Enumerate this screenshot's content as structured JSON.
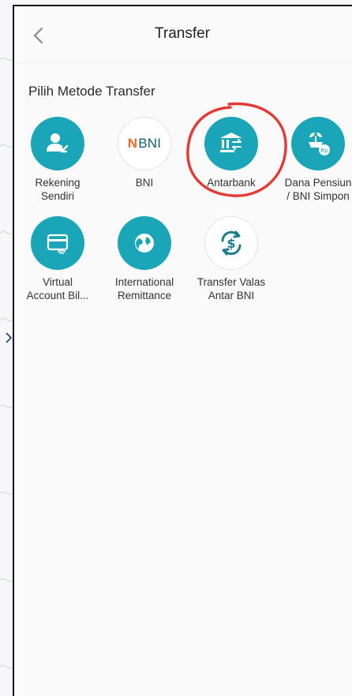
{
  "header": {
    "title": "Transfer"
  },
  "section": {
    "title": "Pilih Metode Transfer"
  },
  "methods": [
    {
      "label_line1": "Rekening",
      "label_line2": "Sendiri",
      "icon": "user-arrow-icon"
    },
    {
      "label_line1": "BNI",
      "label_line2": "",
      "icon": "bni-logo",
      "logo_mark": "N",
      "logo_text": "BNI"
    },
    {
      "label_line1": "Antarbank",
      "label_line2": "",
      "icon": "bank-transfer-icon"
    },
    {
      "label_line1": "Dana Pensiun",
      "label_line2": "/ BNI Simpon",
      "icon": "plant-rp-icon"
    },
    {
      "label_line1": "Virtual",
      "label_line2": "Account Bil...",
      "icon": "card-wifi-icon"
    },
    {
      "label_line1": "International",
      "label_line2": "Remittance",
      "icon": "globe-icon"
    },
    {
      "label_line1": "Transfer Valas",
      "label_line2": "Antar BNI",
      "icon": "dollar-exchange-icon"
    }
  ],
  "colors": {
    "teal": "#1aa6b8",
    "highlight_red": "#e53935",
    "bni_orange": "#f26a21",
    "bni_teal": "#10606e"
  }
}
